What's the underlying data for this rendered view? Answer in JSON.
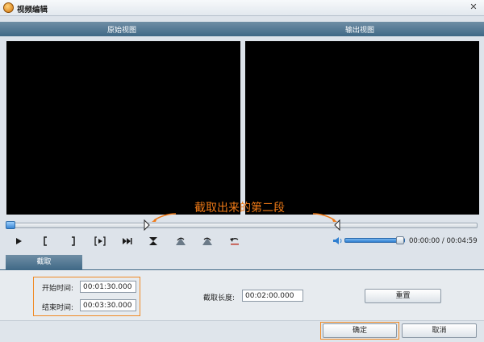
{
  "window": {
    "title": "视频编辑",
    "close_glyph": "✕"
  },
  "views": {
    "source_label": "原始视图",
    "output_label": "输出视图"
  },
  "annotation": {
    "text": "截取出来的第二段",
    "color": "#f07a16"
  },
  "timeline": {
    "position_fraction": 0.0,
    "start_marker_fraction": 0.3,
    "end_marker_fraction": 0.7
  },
  "controls": {
    "buttons": [
      "play",
      "mark-in",
      "mark-out",
      "play-selection",
      "go-to-end",
      "split",
      "rotate-left",
      "rotate-right",
      "undo"
    ]
  },
  "volume": {
    "level_fraction": 0.87
  },
  "time": {
    "display": "00:00:00 / 00:04:59"
  },
  "tabs": [
    {
      "label": "截取",
      "active": true
    }
  ],
  "trim": {
    "start_label": "开始时间:",
    "start_value": "00:01:30.000",
    "end_label": "结束时间:",
    "end_value": "00:03:30.000",
    "length_label": "截取长度:",
    "length_value": "00:02:00.000",
    "reset_label": "重置"
  },
  "footer": {
    "ok_label": "确定",
    "cancel_label": "取消"
  },
  "colors": {
    "header": "#3f6886",
    "highlight": "#f08a24",
    "accent": "#2f7fd0"
  }
}
